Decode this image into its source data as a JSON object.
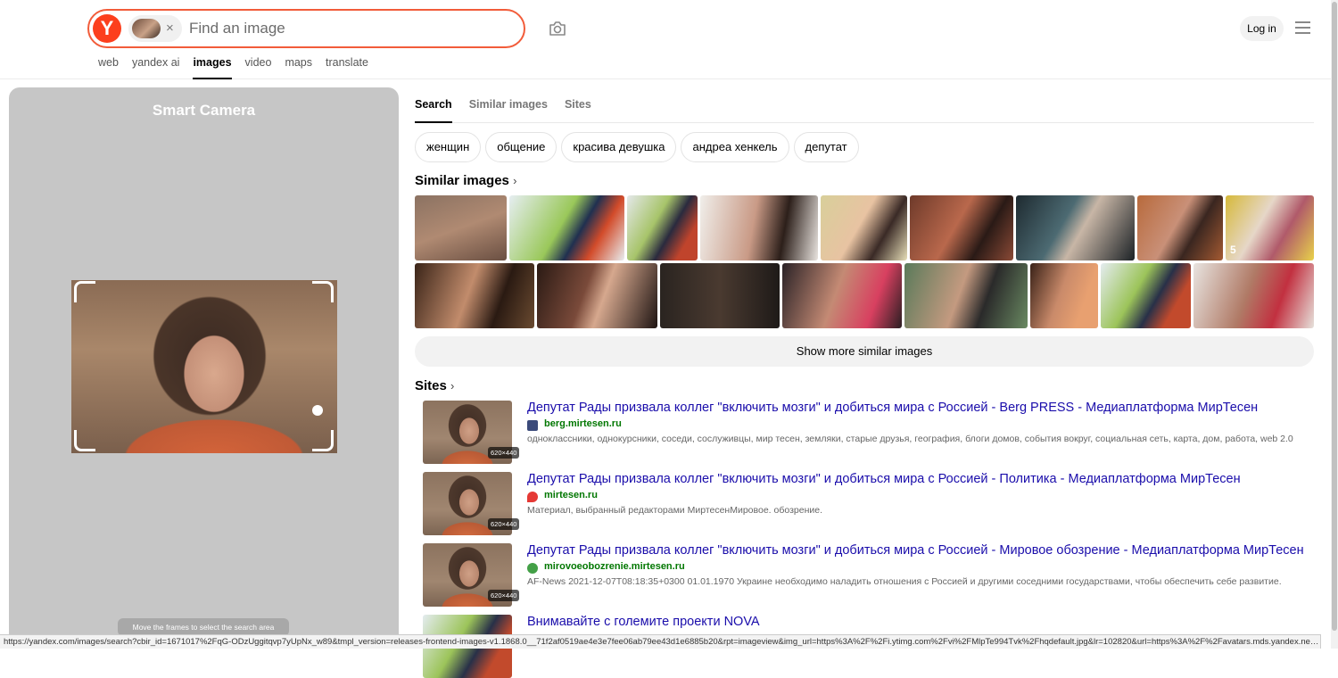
{
  "header": {
    "logo_letter": "Y",
    "search_placeholder": "Find an image",
    "clear_symbol": "×",
    "login_label": "Log in",
    "nav": [
      {
        "label": "web",
        "active": false
      },
      {
        "label": "yandex ai",
        "active": false
      },
      {
        "label": "images",
        "active": true
      },
      {
        "label": "video",
        "active": false
      },
      {
        "label": "maps",
        "active": false
      },
      {
        "label": "translate",
        "active": false
      }
    ],
    "icons": [
      "camera-search-icon",
      "menu-icon",
      "clear-icon"
    ]
  },
  "left_panel": {
    "title": "Smart Camera",
    "hint": "Move the frames to select the search area"
  },
  "right_panel": {
    "tabs": [
      {
        "label": "Search",
        "active": true
      },
      {
        "label": "Similar images",
        "active": false
      },
      {
        "label": "Sites",
        "active": false
      }
    ],
    "tags": [
      "женщин",
      "общение",
      "красива девушка",
      "андреа хенкель",
      "депутат"
    ],
    "similar_heading": "Similar images",
    "show_more": "Show more similar images",
    "sites_heading": "Sites",
    "video_badge": "5",
    "results": [
      {
        "title": "Депутат Рады призвала коллег \"включить мозги\" и добиться мира с Россией - Berg PRESS - Медиаплатформа МирТесен",
        "domain": "berg.mirtesen.ru",
        "description": "одноклассники, однокурсники, соседи, сослуживцы, мир тесен, земляки, старые друзья, география, блоги домов, события вокруг, социальная сеть, карта, дом, работа, web 2.0",
        "size": "620×440",
        "favicon_color": "#3b4a7a"
      },
      {
        "title": "Депутат Рады призвала коллег \"включить мозги\" и добиться мира с Россией - Политика - Медиаплатформа МирТесен",
        "domain": "mirtesen.ru",
        "description": "Материал, выбранный редакторами МиртесенМировое. обозрение.",
        "size": "620×440",
        "favicon_color": "#e53935"
      },
      {
        "title": "Депутат Рады призвала коллег \"включить мозги\" и добиться мира с Россией - Мировое обозрение - Медиаплатформа МирТесен",
        "domain": "mirovoeobozrenie.mirtesen.ru",
        "description": "AF-News 2021-12-07T08:18:35+0300 01.01.1970 Украине необходимо наладить отношения с Россией и другими соседними государствами, чтобы обеспечить себе развитие.",
        "size": "620×440",
        "favicon_color": "#43a047"
      },
      {
        "title": "Внимавайте с големите проекти NOVA",
        "domain": "",
        "description": "",
        "size": "",
        "favicon_color": "#1565c0"
      }
    ]
  },
  "status_url": "https://yandex.com/images/search?cbir_id=1671017%2FqG-ODzUggitqvp7yUpNx_w89&tmpl_version=releases-frontend-images-v1.1868.0__71f2af0519ae4e3e7fee06ab79ee43d1e6885b20&rpt=imageview&img_url=https%3A%2F%2Fi.ytimg.com%2Fvi%2FMlpTe994Tvk%2Fhqdefault.jpg&lr=102820&url=https%3A%2F%2Favatars.mds.yandex.net%2Fget-images-cbir%2F1671017%2FqG-ODzUggitqvp7yUpNx_w89"
}
